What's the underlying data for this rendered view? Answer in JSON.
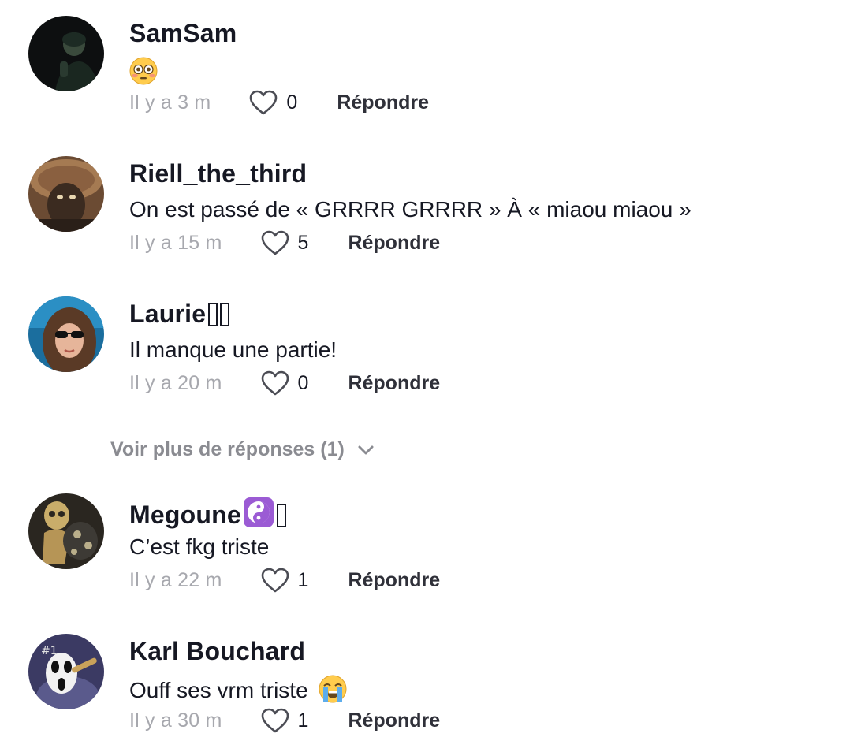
{
  "comments": [
    {
      "username": "SamSam",
      "text": "",
      "emoji": "flushed-face",
      "time": "Il y a 3 m",
      "likes": "0",
      "reply_label": "Répondre"
    },
    {
      "username": "Riell_the_third",
      "text": "On est passé de « GRRRR GRRRR » À « miaou miaou »",
      "time": "Il y a 15 m",
      "likes": "5",
      "reply_label": "Répondre"
    },
    {
      "username": "Laurie",
      "text": "Il manque une partie!",
      "time": "Il y a 20 m",
      "likes": "0",
      "reply_label": "Répondre"
    },
    {
      "username": "Megoune",
      "text": "C’est fkg triste",
      "badge": "yin-yang",
      "time": "Il y a 22 m",
      "likes": "1",
      "reply_label": "Répondre"
    },
    {
      "username": "Karl Bouchard",
      "text": "Ouff ses vrm triste",
      "emoji": "loudly-crying-face",
      "time": "Il y a 30 m",
      "likes": "1",
      "reply_label": "Répondre"
    }
  ],
  "more_replies": {
    "label": "Voir plus de réponses (1)"
  },
  "colors": {
    "text_primary": "#161823",
    "text_secondary": "#a7a8ae",
    "reply": "#2f3039",
    "more_replies": "#8a8b91"
  }
}
